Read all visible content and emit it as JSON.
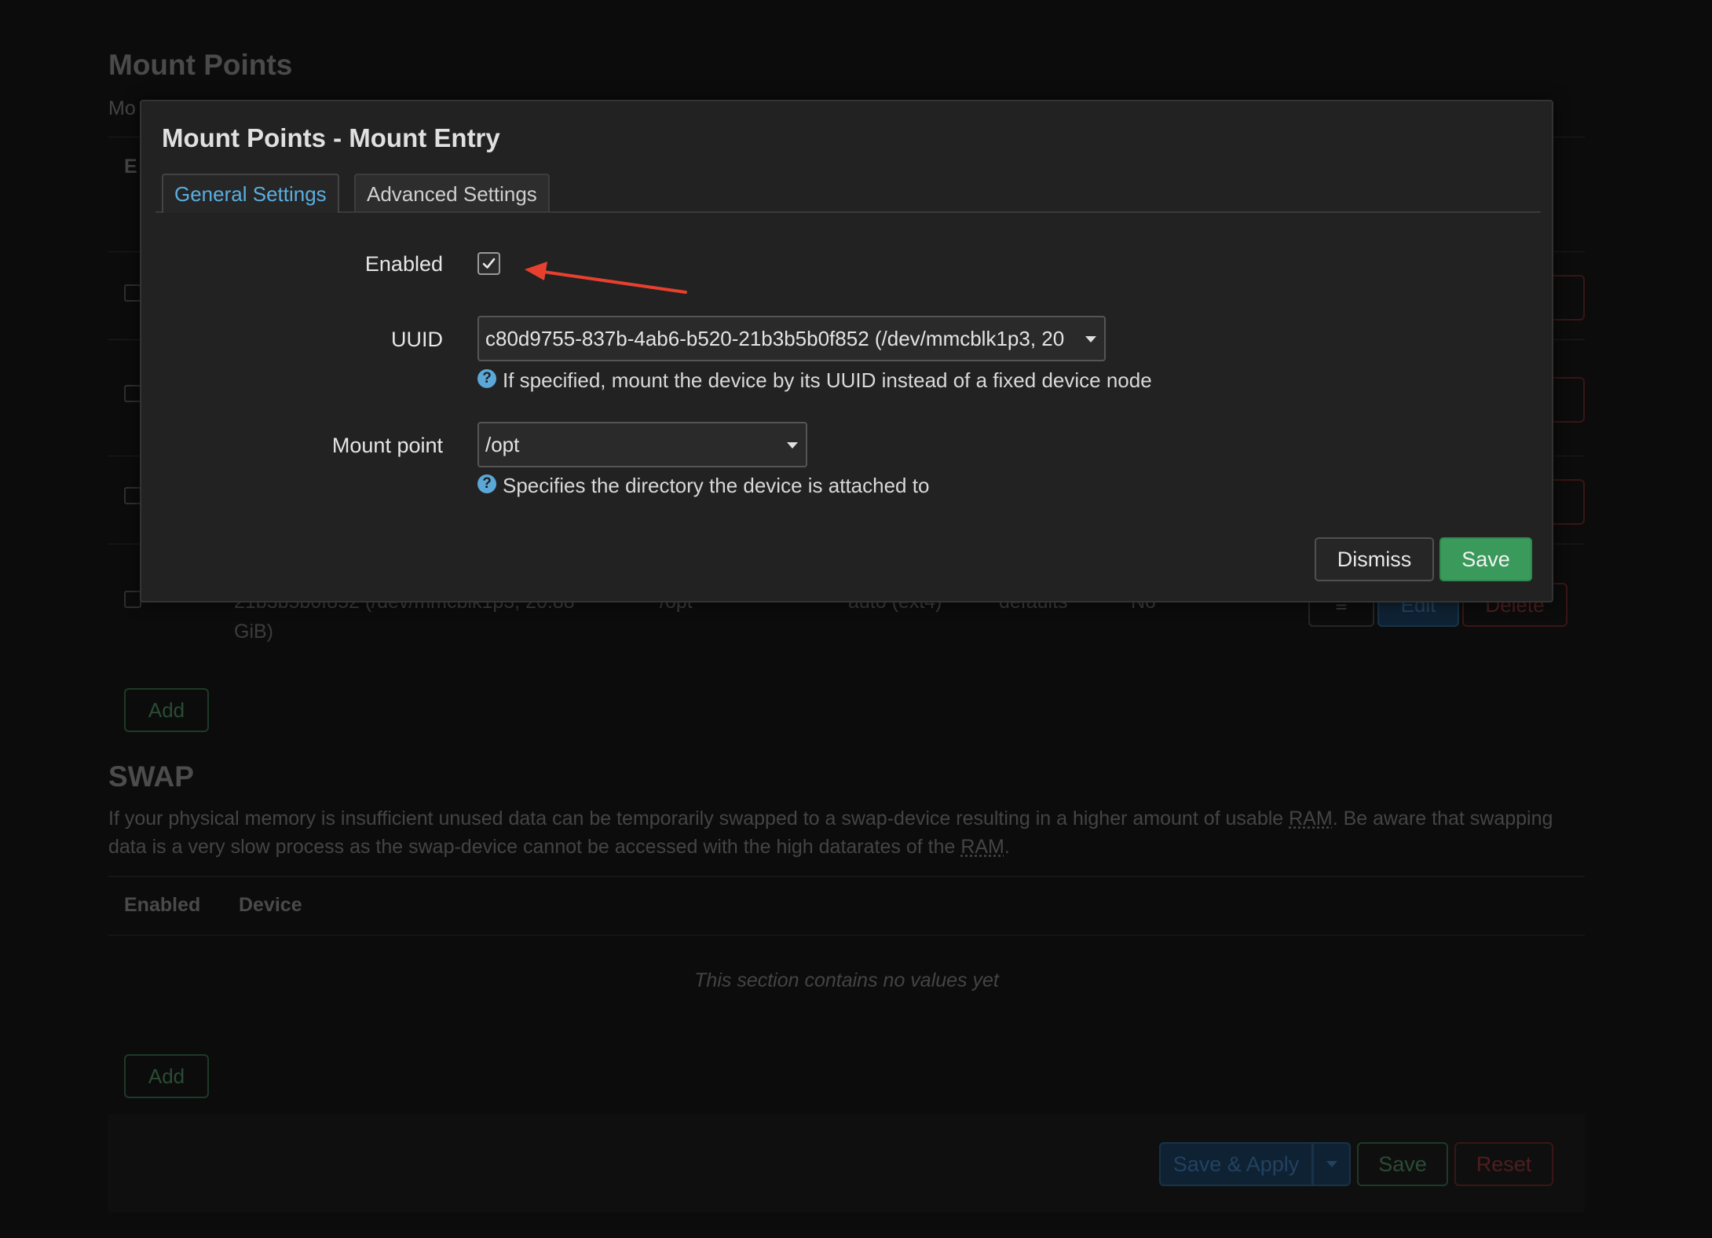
{
  "background": {
    "section_title": "Mount Points",
    "section_desc_partial": "Mo",
    "table_header_partial": "E",
    "partial_row": {
      "uuid_fragment_line1": "21b3b5b0f852 (/dev/mmcblk1p3, 20.88",
      "uuid_fragment_line2": "GiB)",
      "mount_point": "/opt",
      "filesystem": "auto (ext4)",
      "options": "defaults",
      "root": "No",
      "menu_icon": "≡",
      "edit_label": "Edit",
      "delete_label": "Delete"
    },
    "add_label": "Add",
    "swap": {
      "title": "SWAP",
      "desc_before_ram1": "If your physical memory is insufficient unused data can be temporarily swapped to a swap-device resulting in a higher amount of usable ",
      "ram_abbr": "RAM",
      "desc_middle": ". Be aware that swapping data is a very slow process as the swap-device cannot be accessed with the high datarates of the ",
      "desc_end": ".",
      "columns": [
        "Enabled",
        "Device"
      ],
      "empty_text": "This section contains no values yet",
      "add_label": "Add"
    },
    "footer": {
      "save_apply_label": "Save & Apply",
      "save_label": "Save",
      "reset_label": "Reset"
    }
  },
  "modal": {
    "title": "Mount Points - Mount Entry",
    "tabs": [
      {
        "label": "General Settings",
        "active": true
      },
      {
        "label": "Advanced Settings",
        "active": false
      }
    ],
    "fields": {
      "enabled": {
        "label": "Enabled",
        "checked": true
      },
      "uuid": {
        "label": "UUID",
        "value": "c80d9755-837b-4ab6-b520-21b3b5b0f852 (/dev/mmcblk1p3, 20",
        "help": "If specified, mount the device by its UUID instead of a fixed device node"
      },
      "mount_point": {
        "label": "Mount point",
        "value": "/opt",
        "help": "Specifies the directory the device is attached to"
      }
    },
    "help_icon": "?",
    "buttons": {
      "dismiss": "Dismiss",
      "save": "Save"
    }
  },
  "colors": {
    "tab_active": "#5aaee0",
    "save_green": "#3a9a5b",
    "annotation_arrow": "#e8402e",
    "help_icon": "#5aa7d8"
  }
}
